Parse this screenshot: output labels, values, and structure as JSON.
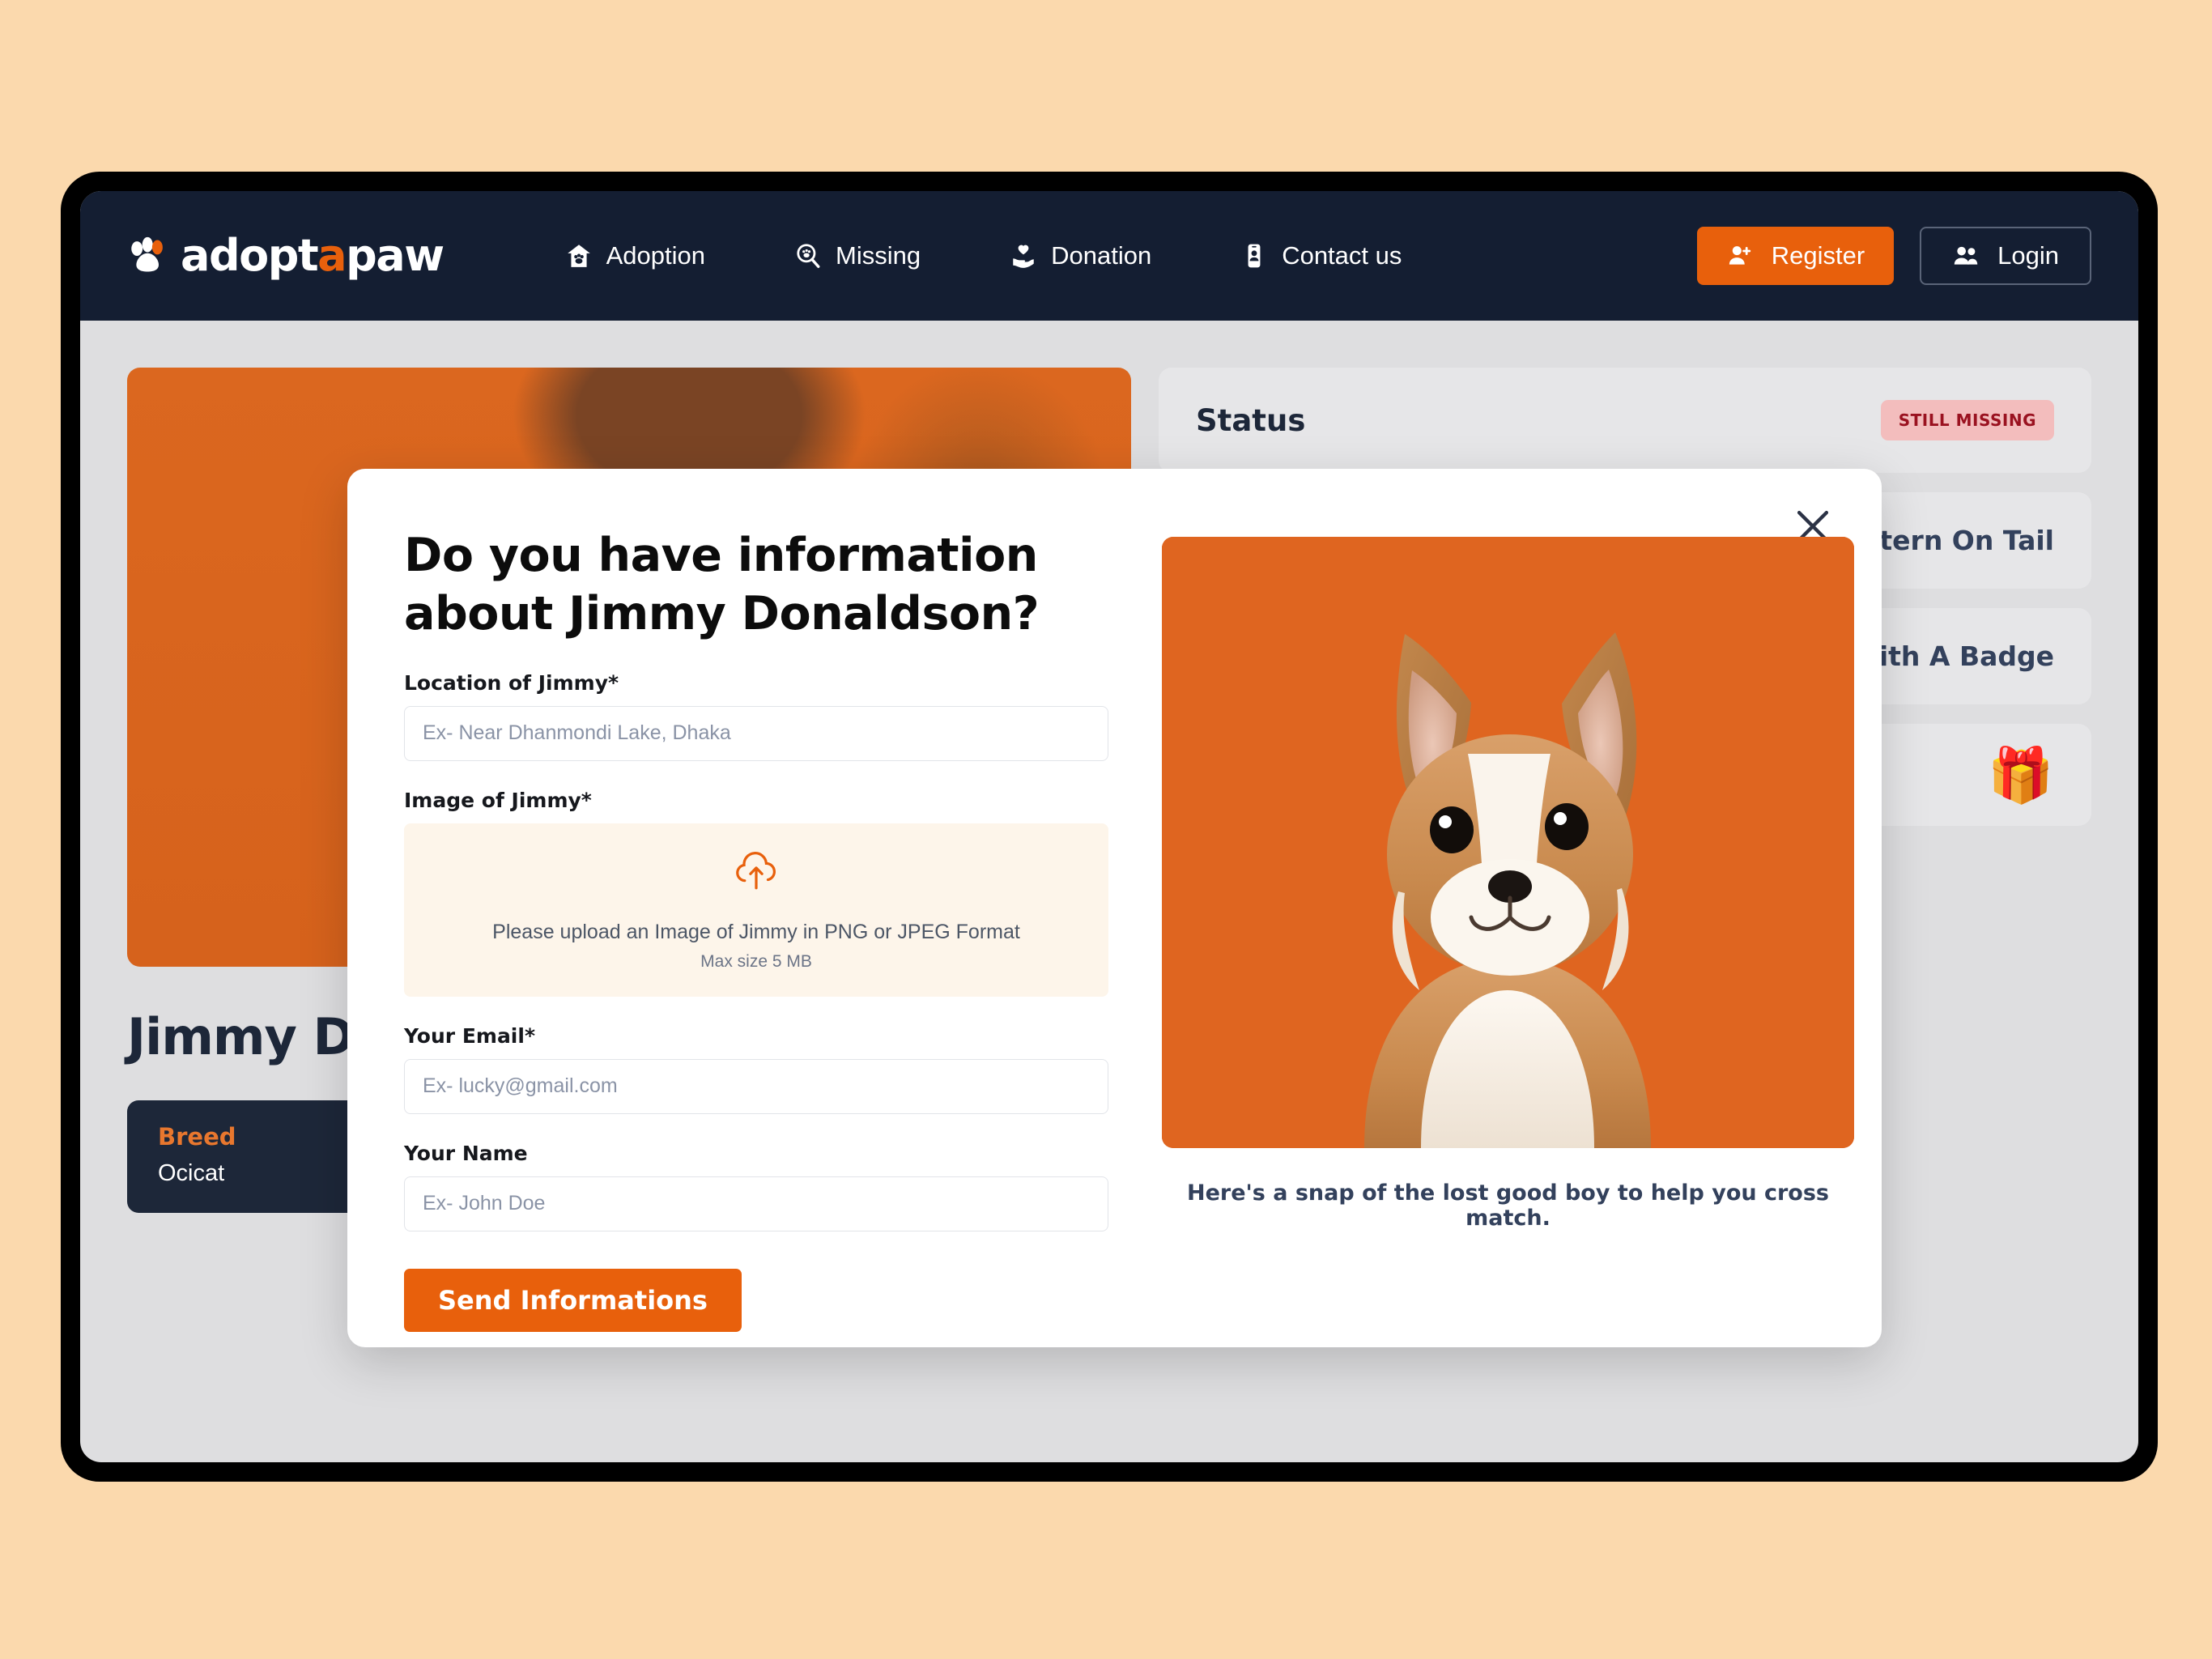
{
  "colors": {
    "page_background": "#FBD9AD",
    "navbar": "#141E32",
    "accent_orange": "#E8600C",
    "screen_background": "#DEDEE0",
    "card_background": "#E6E6E8",
    "badge_background": "#F3BDBD",
    "badge_text": "#9A1220",
    "upload_zone": "#FDF5EA"
  },
  "navbar": {
    "brand": {
      "icon": "paw-icon",
      "part1": "adopt",
      "accent": "a",
      "part2": "paw"
    },
    "links": [
      {
        "label": "Adoption",
        "icon": "house-paw-icon"
      },
      {
        "label": "Missing",
        "icon": "magnifier-paw-icon"
      },
      {
        "label": "Donation",
        "icon": "heart-hand-icon"
      },
      {
        "label": "Contact us",
        "icon": "contact-card-icon"
      }
    ],
    "register_label": "Register",
    "register_icon": "user-plus-icon",
    "login_label": "Login",
    "login_icon": "users-icon"
  },
  "page": {
    "pet_name": "Jimmy Donaldson",
    "breed_label": "Breed",
    "breed_value": "Ocicat",
    "status_title": "Status",
    "status_badge": "STILL MISSING",
    "detail_items": [
      "Black Stripped Pattern On Tail",
      "Red Neck Collar With A Badge"
    ],
    "gift_icon": "gift-emoji",
    "gift_glyph": "🎁"
  },
  "modal": {
    "close_icon": "close-icon",
    "title": "Do you have information about Jimmy Donaldson?",
    "fields": [
      {
        "label": "Location of Jimmy*",
        "placeholder": "Ex- Near Dhanmondi Lake, Dhaka",
        "value": ""
      },
      {
        "label": "Your Email*",
        "placeholder": "Ex- lucky@gmail.com",
        "value": ""
      },
      {
        "label": "Your Name",
        "placeholder": "Ex- John Doe",
        "value": ""
      }
    ],
    "upload": {
      "label": "Image of Jimmy*",
      "icon": "cloud-upload-icon",
      "primary_text": "Please upload an Image of Jimmy in PNG or JPEG Format",
      "secondary_text": "Max size 5 MB"
    },
    "submit_label": "Send Informations",
    "photo_alt": "corgi-puppy-photo",
    "caption": "Here's a snap of the lost good boy to help you cross match."
  }
}
